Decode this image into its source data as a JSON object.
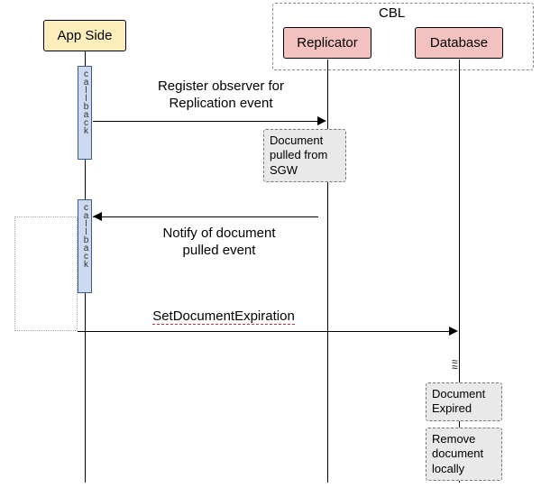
{
  "participants": {
    "app_side": "App Side",
    "replicator": "Replicator",
    "database": "Database",
    "cbl_group": "CBL"
  },
  "activations": {
    "callback1": "callback",
    "callback2": "callback"
  },
  "messages": {
    "register": "Register observer for\nReplication event",
    "pulled_note": "Document\npulled from\nSGW",
    "notify": "Notify of document\npulled event",
    "set_expiration": "SetDocumentExpiration",
    "expired_note": "Document\nExpired",
    "remove_note": "Remove\ndocument\nlocally"
  }
}
